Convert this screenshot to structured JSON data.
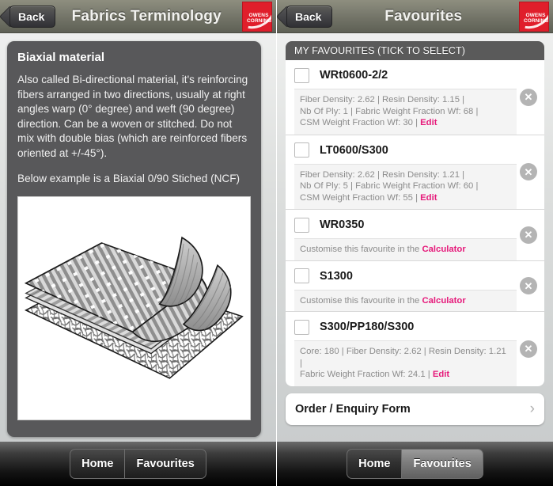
{
  "left": {
    "navbar": {
      "back_label": "Back",
      "title": "Fabrics Terminology",
      "logo_text": "OWENS\nCORNING"
    },
    "term": {
      "title": "Biaxial material",
      "paragraph1": "Also called Bi-directional material, it's reinforcing fibers arranged in two directions, usually at right angles warp (0° degree) and weft (90 degree) direction. Can be a woven or stitched. Do not mix with double bias (which are reinforced fibers oriented at +/-45°).",
      "paragraph2": "Below example is a Biaxial 0/90 Stiched (NCF)",
      "figure_alt": "biaxial-fabric-layers-diagram"
    },
    "tabs": [
      {
        "label": "Home",
        "active": false
      },
      {
        "label": "Favourites",
        "active": false
      }
    ]
  },
  "right": {
    "navbar": {
      "back_label": "Back",
      "title": "Favourites",
      "logo_text": "OWENS\nCORNING"
    },
    "group_header": "MY FAVOURITES (TICK TO SELECT)",
    "favourites": [
      {
        "name": "WRt0600-2/2",
        "checked": false,
        "detail_lines": [
          "Fiber Density: 2.62 | Resin Density: 1.15 |",
          "Nb Of Ply: 1 | Fabric Weight Fraction Wf: 68 |",
          "CSM Weight Fraction Wf: 30 | "
        ],
        "link_text": "Edit",
        "delete_label": "✕"
      },
      {
        "name": "LT0600/S300",
        "checked": false,
        "detail_lines": [
          "Fiber Density: 2.62 | Resin Density: 1.21 |",
          "Nb Of Ply: 5 | Fabric Weight Fraction Wf: 60 |",
          "CSM Weight Fraction Wf: 55 | "
        ],
        "link_text": "Edit",
        "delete_label": "✕"
      },
      {
        "name": "WR0350",
        "checked": false,
        "detail_lines": [
          "Customise this favourite in the "
        ],
        "link_text": "Calculator",
        "delete_label": "✕"
      },
      {
        "name": "S1300",
        "checked": false,
        "detail_lines": [
          "Customise this favourite in the "
        ],
        "link_text": "Calculator",
        "delete_label": "✕"
      },
      {
        "name": "S300/PP180/S300",
        "checked": false,
        "detail_lines": [
          "Core: 180 | Fiber Density: 2.62 | Resin Density: 1.21 |",
          "Fabric Weight Fraction Wf: 24.1 | "
        ],
        "link_text": "Edit",
        "delete_label": "✕"
      }
    ],
    "order_button": {
      "label": "Order / Enquiry Form",
      "chevron": "›"
    },
    "tabs": [
      {
        "label": "Home",
        "active": false
      },
      {
        "label": "Favourites",
        "active": true
      }
    ]
  },
  "colors": {
    "accent_pink": "#e6197a",
    "brand_red": "#e01e2b",
    "card_dark": "#58585a",
    "group_header": "#5a5a5a"
  }
}
